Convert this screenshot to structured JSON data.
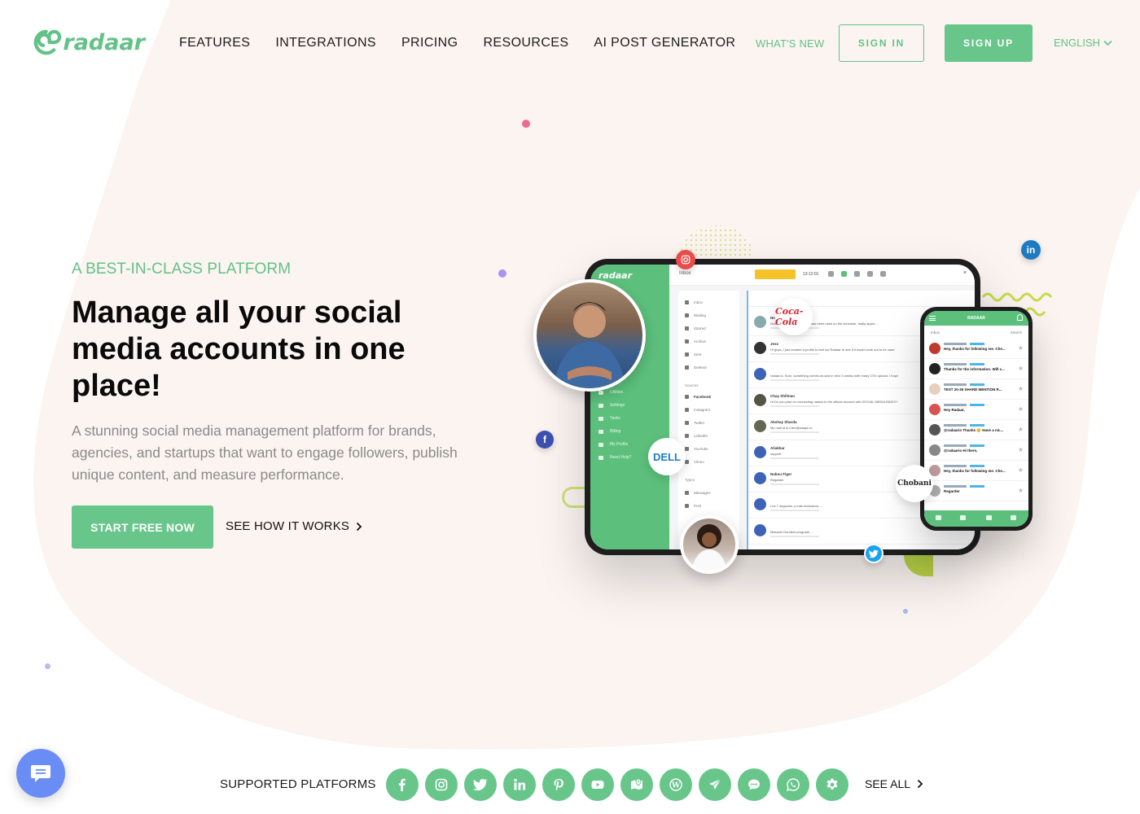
{
  "brand": {
    "name": "radaar",
    "accent": "#68c68b",
    "accent_text": "#62c287",
    "blob_color": "#fbf4f1"
  },
  "nav": {
    "items": [
      "FEATURES",
      "INTEGRATIONS",
      "PRICING",
      "RESOURCES",
      "AI POST GENERATOR"
    ],
    "whats_new": "WHAT'S NEW",
    "sign_in": "SIGN IN",
    "sign_up": "SIGN UP",
    "language": "ENGLISH"
  },
  "hero": {
    "eyebrow": "A BEST-IN-CLASS PLATFORM",
    "headline": "Manage all your social media accounts in one place!",
    "subtext": "A stunning social media management platform for brands, agencies, and startups that want to engage followers, publish unique content, and measure performance.",
    "cta_primary": "START FREE NOW",
    "cta_secondary": "SEE HOW IT WORKS"
  },
  "mockup": {
    "tablet": {
      "logo": "radaar",
      "inbox_label": "Inbox",
      "time": "13:12:01",
      "sidebar_items": [
        "Utilities",
        "Settings",
        "Tasks",
        "Billing",
        "My Profile",
        "Need Help?"
      ],
      "folders": [
        "Inbox",
        "Waiting",
        "Starred",
        "Archive",
        "Sent",
        "Deleted"
      ],
      "sources_header": "Sources",
      "sources": [
        "Facebook",
        "Instagram",
        "Twitter",
        "LinkedIn",
        "YouTube",
        "Vimeo"
      ],
      "types_header": "Types",
      "types": [
        "Messages",
        "Post"
      ],
      "messages": [
        {
          "name": "Nel",
          "text": "Great ... that social channel has been used on the schedule, really appre..."
        },
        {
          "name": "Jess",
          "text": "Hi guys, I just created a profile to test out Radaar to see if it would work out to be used"
        },
        {
          "name": "",
          "text": "radaar.io, Sure, something comes around in next 3 weeks with ready CSV upload, I hope"
        },
        {
          "name": "Chay Shifman",
          "text": "Hi Do you plan on connecting radaar to the official account with SOCIAL MEDIA INDEX?"
        },
        {
          "name": "Akshay Sharda",
          "text": "My mail id is Care@waapi.co"
        },
        {
          "name": "Aliakbar",
          "text": "support"
        },
        {
          "name": "Nabou Figer",
          "text": "Regarder"
        },
        {
          "name": "",
          "text": "Los 7 negocios, y mas exclusivos ..."
        },
        {
          "name": "",
          "text": "Mekanin Dundeni programi ..."
        }
      ]
    },
    "phone": {
      "title": "RADAAR",
      "inbox_label": "Inbox",
      "search_label": "Search",
      "messages": [
        "Hey, thanks for following me. Che...",
        "Thanks for the information. Will c...",
        "TEST 20-35 SHARE MENTION R...",
        "Hey Radaar,",
        "@radaario Thanks 😊 Have a nic...",
        "@radaario Hi there,",
        "Hey, thanks for following me. Che...",
        "Regarder"
      ]
    },
    "brand_bubbles": [
      "Coca-Cola",
      "DELL",
      "Chobani"
    ]
  },
  "platforms": {
    "label": "SUPPORTED PLATFORMS",
    "items": [
      {
        "name": "facebook",
        "glyph": "f"
      },
      {
        "name": "instagram",
        "glyph": ""
      },
      {
        "name": "twitter",
        "glyph": ""
      },
      {
        "name": "linkedin",
        "glyph": "in"
      },
      {
        "name": "pinterest",
        "glyph": "p"
      },
      {
        "name": "youtube",
        "glyph": ""
      },
      {
        "name": "google-maps",
        "glyph": ""
      },
      {
        "name": "wordpress",
        "glyph": "W"
      },
      {
        "name": "telegram",
        "glyph": ""
      },
      {
        "name": "sms",
        "glyph": "SMS"
      },
      {
        "name": "whatsapp",
        "glyph": ""
      },
      {
        "name": "settings",
        "glyph": ""
      }
    ],
    "see_all": "SEE ALL"
  }
}
